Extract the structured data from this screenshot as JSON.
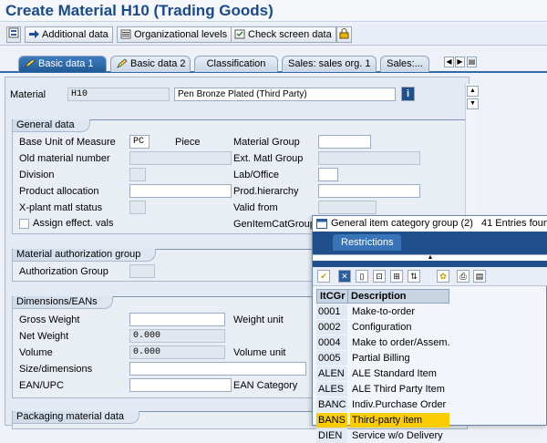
{
  "title": "Create Material H10 (Trading Goods)",
  "toolbar": {
    "additional_data": "Additional data",
    "org_levels": "Organizational levels",
    "check_screen": "Check screen data"
  },
  "tabs": [
    "Basic data 1",
    "Basic data 2",
    "Classification",
    "Sales: sales org. 1",
    "Sales:..."
  ],
  "material": {
    "label": "Material",
    "number": "H10",
    "description": "Pen Bronze Plated (Third Party)"
  },
  "general_data": {
    "heading": "General data",
    "base_uom_label": "Base Unit of Measure",
    "base_uom_value": "PC",
    "base_uom_text": "Piece",
    "old_material_label": "Old material number",
    "division_label": "Division",
    "product_allocation_label": "Product allocation",
    "xplant_status_label": "X-plant matl status",
    "assign_effect_label": "Assign effect. vals",
    "material_group_label": "Material Group",
    "ext_matl_group_label": "Ext. Matl Group",
    "lab_office_label": "Lab/Office",
    "prod_hierarchy_label": "Prod.hierarchy",
    "valid_from_label": "Valid from",
    "gen_item_cat_label": "GenItemCatGroup"
  },
  "auth_group": {
    "heading": "Material authorization group",
    "label": "Authorization Group"
  },
  "dimensions": {
    "heading": "Dimensions/EANs",
    "gross_weight_label": "Gross Weight",
    "net_weight_label": "Net Weight",
    "net_weight_value": "0.000",
    "volume_label": "Volume",
    "volume_value": "0.000",
    "size_label": "Size/dimensions",
    "ean_label": "EAN/UPC",
    "weight_unit_label": "Weight unit",
    "volume_unit_label": "Volume unit",
    "ean_category_label": "EAN Category"
  },
  "packaging": {
    "heading": "Packaging material data"
  },
  "popup": {
    "title": "General item category group (2)",
    "entries": "41 Entries found",
    "tab_restrictions": "Restrictions",
    "columns": [
      "ItCGr",
      "Description"
    ],
    "rows": [
      {
        "code": "0001",
        "desc": "Make-to-order"
      },
      {
        "code": "0002",
        "desc": "Configuration"
      },
      {
        "code": "0004",
        "desc": "Make to order/Assem."
      },
      {
        "code": "0005",
        "desc": "Partial Billing"
      },
      {
        "code": "ALEN",
        "desc": "ALE Standard Item"
      },
      {
        "code": "ALES",
        "desc": "ALE Third Party Item"
      },
      {
        "code": "BANC",
        "desc": "Indiv.Purchase Order"
      },
      {
        "code": "BANS",
        "desc": "Third-party item"
      },
      {
        "code": "DIEN",
        "desc": "Service w/o Delivery"
      }
    ],
    "selected_code": "BANS"
  },
  "colors": {
    "title": "#1a4a8c",
    "active_tab": "#2f6aa8",
    "popup_band": "#1f4f8c",
    "selection": "#f9cd00"
  }
}
